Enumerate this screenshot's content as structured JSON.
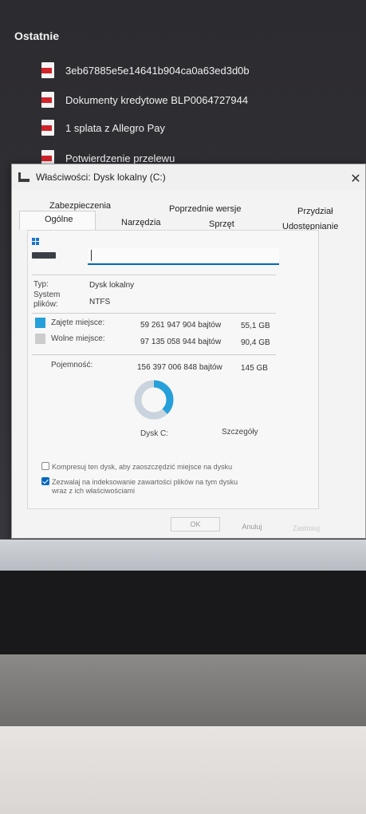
{
  "recent": {
    "title": "Ostatnie",
    "items": [
      {
        "label": "3eb67885e5e14641b904ca0a63ed3d0b",
        "icon": "pdf-file-icon"
      },
      {
        "label": "Dokumenty kredytowe BLP0064727944",
        "icon": "pdf-file-icon"
      },
      {
        "label": "1 splata z Allegro Pay",
        "icon": "pdf-file-icon"
      },
      {
        "label": "Potwierdzenie przelewu",
        "icon": "pdf-file-icon"
      }
    ]
  },
  "dialog": {
    "title": "Właściwości: Dysk lokalny (C:)",
    "close": "✕",
    "tabs": {
      "row1": [
        "Zabezpieczenia",
        "Poprzednie wersje",
        "Przydział"
      ],
      "row2": [
        "Ogólne",
        "Narzędzia",
        "Sprzęt",
        "Udostępnianie"
      ],
      "active": "Ogólne"
    },
    "name_value": "",
    "type_label": "Typ:",
    "type_value": "Dysk lokalny",
    "fs_label": "System plików:",
    "fs_value": "NTFS",
    "used": {
      "label": "Zajęte miejsce:",
      "bytes": "59 261 947 904 bajtów",
      "size": "55,1 GB",
      "color": "#26a0da"
    },
    "free": {
      "label": "Wolne miejsce:",
      "bytes": "97 135 058 944 bajtów",
      "size": "90,4 GB",
      "color": "#cccccc"
    },
    "capacity": {
      "label": "Pojemność:",
      "bytes": "156 397 006 848 bajtów",
      "size": "145 GB"
    },
    "used_fraction": 0.379,
    "drive_label": "Dysk C:",
    "details_button": "Szczegóły",
    "compress_label": "Kompresuj ten dysk, aby zaoszczędzić miejsce na dysku",
    "compress_checked": false,
    "index_label_1": "Zezwalaj na indeksowanie zawartości plików na tym dysku",
    "index_label_2": "wraz z ich właściwościami",
    "index_checked": true,
    "ok": "OK",
    "cancel": "Anuluj",
    "apply": "Zastosuj"
  }
}
